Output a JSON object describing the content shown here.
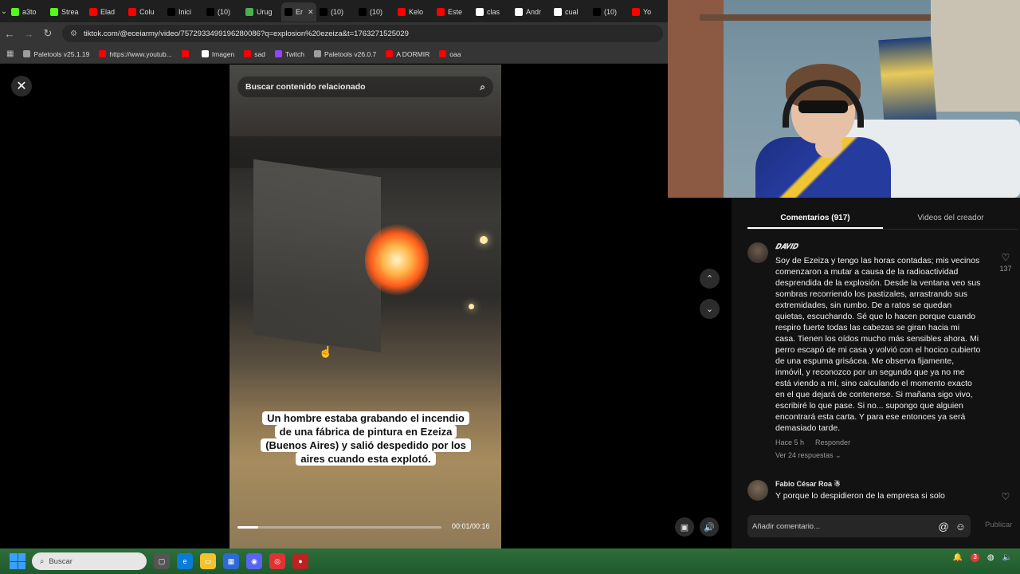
{
  "browser": {
    "tabs": [
      {
        "title": "a3to",
        "icon": "k-icon",
        "color": "#53fc18"
      },
      {
        "title": "Strea",
        "icon": "k-icon",
        "color": "#53fc18"
      },
      {
        "title": "Elad",
        "icon": "youtube-icon",
        "color": "#ff0000"
      },
      {
        "title": "Colu",
        "icon": "youtube-icon",
        "color": "#ff0000"
      },
      {
        "title": "Inici",
        "icon": "x-icon",
        "color": "#000000"
      },
      {
        "title": "(10)",
        "icon": "tiktok-icon",
        "color": "#000000"
      },
      {
        "title": "Urug",
        "icon": "shield-icon",
        "color": "#4caf50"
      },
      {
        "title": "Er",
        "icon": "tiktok-icon",
        "color": "#000000"
      },
      {
        "title": "(10)",
        "icon": "tiktok-icon",
        "color": "#000000"
      },
      {
        "title": "(10)",
        "icon": "tiktok-icon",
        "color": "#000000"
      },
      {
        "title": "Kelo",
        "icon": "youtube-icon",
        "color": "#ff0000"
      },
      {
        "title": "Este",
        "icon": "youtube-icon",
        "color": "#ff0000"
      },
      {
        "title": "clas",
        "icon": "google-icon",
        "color": "#ffffff"
      },
      {
        "title": "Andr",
        "icon": "wikipedia-icon",
        "color": "#ffffff"
      },
      {
        "title": "cual",
        "icon": "google-icon",
        "color": "#ffffff"
      },
      {
        "title": "(10)",
        "icon": "tiktok-icon",
        "color": "#000000"
      },
      {
        "title": "Yo",
        "icon": "youtube-icon",
        "color": "#ff0000"
      }
    ],
    "url": "tiktok.com/@eceiarmy/video/7572933499196280086?q=explosion%20ezeiza&t=1763271525029",
    "bookmarks": [
      {
        "label": "Paletools v25.1.19",
        "color": "#9e9e9e"
      },
      {
        "label": "https://www.youtub...",
        "color": "#ff0000"
      },
      {
        "label": "",
        "color": "#ff0000"
      },
      {
        "label": "Imagen",
        "color": "#ffffff"
      },
      {
        "label": "sad",
        "color": "#ff0000"
      },
      {
        "label": "Twitch",
        "color": "#9146ff"
      },
      {
        "label": "Paletools v26.0.7",
        "color": "#9e9e9e"
      },
      {
        "label": "A DORMIR",
        "color": "#ff0000"
      },
      {
        "label": "oaa",
        "color": "#ff0000"
      }
    ]
  },
  "video": {
    "search_placeholder": "Buscar contenido relacionado",
    "caption": "Un hombre estaba grabando el incendio de una fábrica de pintura en Ezeiza (Buenos Aires) y salió despedido por los aires cuando esta explotó.",
    "timecode": "00:01/00:16",
    "progress": 0.1
  },
  "panel": {
    "tabs": [
      "Comentarios (917)",
      "Videos del creador"
    ],
    "comments": [
      {
        "user": "𝑫𝑨𝑽𝑰𝑫",
        "text": "Soy de Ezeiza y tengo las horas contadas; mis vecinos comenzaron a mutar a causa de la radioactividad desprendida de la explosión. Desde la ventana veo sus sombras recorriendo los pastizales, arrastrando sus extremidades, sin rumbo. De a ratos se quedan quietas, escuchando. Sé que lo hacen porque cuando respiro fuerte todas las cabezas se giran hacia mi casa. Tienen los oídos mucho más sensibles ahora. Mi perro escapó de mi casa y volvió con el hocico cubierto de una espuma grisácea. Me observa fijamente, inmóvil, y reconozco por un segundo que ya no me está viendo a mí, sino calculando el momento exacto en el que dejará de contenerse. Si mañana sigo vivo, escribiré lo que pase. Si no... supongo que alguien encontrará esta carta. Y para ese entonces ya será demasiado tarde.",
        "time": "Hace 5 h",
        "reply": "Responder",
        "replies": "Ver 24 respuestas",
        "likes": "137"
      },
      {
        "user": "Fabio César Roa ☃",
        "text": "Y porque lo despidieron de la empresa si solo",
        "time": "",
        "reply": "",
        "replies": "",
        "likes": ""
      }
    ],
    "input_placeholder": "Añadir comentario...",
    "publish": "Publicar"
  },
  "taskbar": {
    "search": "Buscar",
    "tray_badge": "3"
  }
}
